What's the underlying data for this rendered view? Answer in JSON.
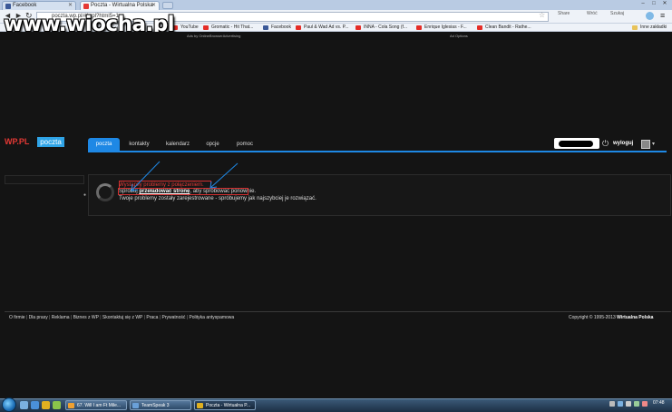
{
  "browser": {
    "tabs": [
      {
        "label": "Facebook",
        "active": false,
        "icon": "facebook-favicon",
        "color": "#3b5998"
      },
      {
        "label": "Poczta - Wirtualna Polska",
        "active": true,
        "icon": "wp-favicon",
        "color": "#e53935"
      }
    ],
    "window_buttons": [
      "–",
      "□",
      "✕"
    ],
    "nav": {
      "back": "◄",
      "forward": "►",
      "reload": "↻"
    },
    "address": "poczta.wp.pl/#/wpl?html5=1",
    "toolbar_right": [
      "Share",
      "Wróć",
      "Szukaj"
    ],
    "bookmarks": [
      {
        "label": "YouTube",
        "icon": "youtube-icon",
        "color": "#e52d27"
      },
      {
        "label": "Gromatic - Hit That...",
        "icon": "youtube-icon",
        "color": "#e52d27"
      },
      {
        "label": "Facebook",
        "icon": "facebook-icon",
        "color": "#3b5998"
      },
      {
        "label": "Paul & Wad Ad vs. P...",
        "icon": "youtube-icon",
        "color": "#e52d27"
      },
      {
        "label": "INNA - Cola Song (f...",
        "icon": "youtube-icon",
        "color": "#e52d27"
      },
      {
        "label": "Enrique Iglesias - F...",
        "icon": "youtube-icon",
        "color": "#e52d27"
      },
      {
        "label": "Clean Bandit - Rathe...",
        "icon": "youtube-icon",
        "color": "#e52d27"
      }
    ],
    "other_bookmarks": "Inne zakładki"
  },
  "watermark": "www.wiocha.pl",
  "ads_bar": {
    "left": "Ads by OnlineBrowserAdvertising",
    "right": "Ad Options"
  },
  "header": {
    "logo_wp": "WP.PL",
    "logo_poczta": "poczta",
    "tabs": [
      {
        "label": "poczta",
        "active": true
      },
      {
        "label": "kontakty",
        "active": false
      },
      {
        "label": "kalendarz",
        "active": false
      },
      {
        "label": "opcje",
        "active": false
      },
      {
        "label": "pomoc",
        "active": false
      }
    ],
    "logout": "wyloguj",
    "power_icon": "⏻",
    "accent": "#1e88e5"
  },
  "content": {
    "error_title": "Wystąpiły problemy z połączeniem.",
    "line1_prefix": "Spróbuj ",
    "line1_link": "przeładować stronę",
    "line1_suffix": ", aby spróbować ponownie.",
    "line2": "Twoje problemy zostały zarejestrowane - spróbujemy jak najszybciej je rozwiązać."
  },
  "footer": {
    "links": [
      "O firmie",
      "Dla prasy",
      "Reklama",
      "Biznes z WP",
      "Skontaktuj się z WP",
      "Praca",
      "Prywatność",
      "Polityka antyspamowa"
    ],
    "copyright_prefix": "Copyright © 1995-2013 ",
    "copyright_brand": "Wirtualna Polska"
  },
  "taskbar": {
    "buttons": [
      {
        "label": "67. Will I am Ft Mile...",
        "icon": "media-icon",
        "color": "#f0a030",
        "active": false
      },
      {
        "label": "TeamSpeak 3",
        "icon": "teamspeak-icon",
        "color": "#6aa0d8",
        "active": false
      },
      {
        "label": "Poczta - Wirtualna P...",
        "icon": "chrome-icon",
        "color": "#e0b020",
        "active": true
      }
    ],
    "clock": "07:48"
  }
}
